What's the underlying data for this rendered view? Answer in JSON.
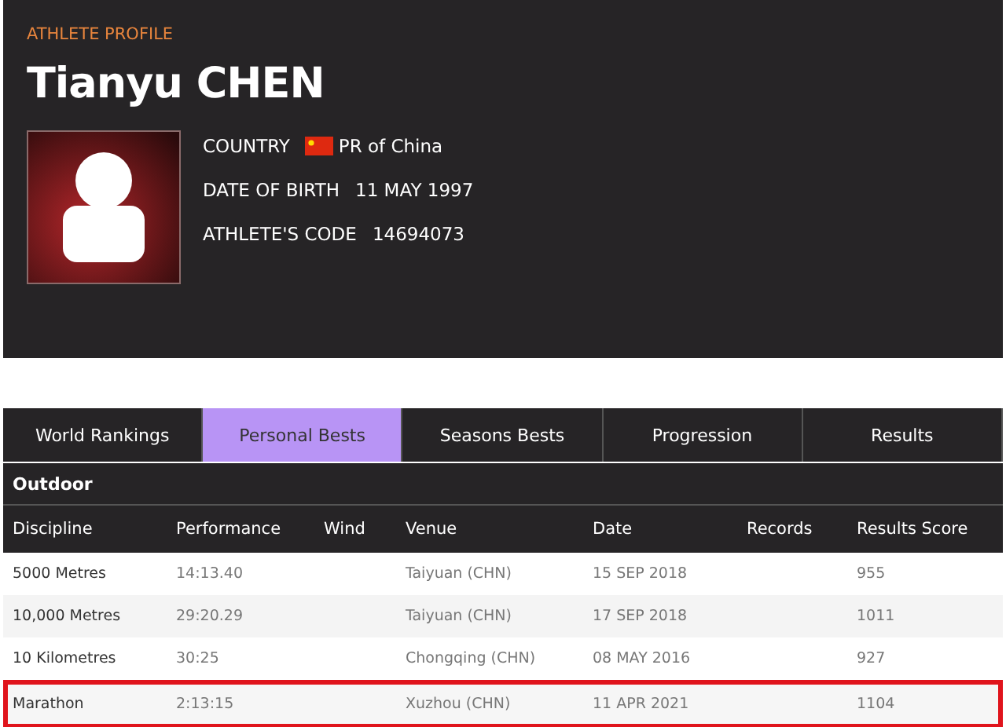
{
  "profile": {
    "label": "ATHLETE PROFILE",
    "name": "Tianyu CHEN",
    "fields": [
      {
        "label": "COUNTRY",
        "value": "PR of China",
        "kind": "flag"
      },
      {
        "label": "DATE OF BIRTH",
        "value": "11 MAY 1997",
        "kind": "text"
      },
      {
        "label": "ATHLETE'S CODE",
        "value": "14694073",
        "kind": "text"
      }
    ]
  },
  "tabs": [
    {
      "label": "World Rankings",
      "selected": false
    },
    {
      "label": "Personal Bests",
      "selected": true
    },
    {
      "label": "Seasons Bests",
      "selected": false
    },
    {
      "label": "Progression",
      "selected": false
    },
    {
      "label": "Results",
      "selected": false
    }
  ],
  "table": {
    "section": "Outdoor",
    "columns": [
      "Discipline",
      "Performance",
      "Wind",
      "Venue",
      "Date",
      "Records",
      "Results Score"
    ],
    "rows": [
      {
        "cells": [
          "5000 Metres",
          "14:13.40",
          "",
          "Taiyuan (CHN)",
          "15 SEP 2018",
          "",
          "955"
        ],
        "highlighted": false
      },
      {
        "cells": [
          "10,000 Metres",
          "29:20.29",
          "",
          "Taiyuan (CHN)",
          "17 SEP 2018",
          "",
          "1011"
        ],
        "highlighted": false
      },
      {
        "cells": [
          "10 Kilometres",
          "30:25",
          "",
          "Chongqing (CHN)",
          "08 MAY 2016",
          "",
          "927"
        ],
        "highlighted": false
      },
      {
        "cells": [
          "Marathon",
          "2:13:15",
          "",
          "Xuzhou (CHN)",
          "11 APR 2021",
          "",
          "1104"
        ],
        "highlighted": true
      }
    ]
  }
}
